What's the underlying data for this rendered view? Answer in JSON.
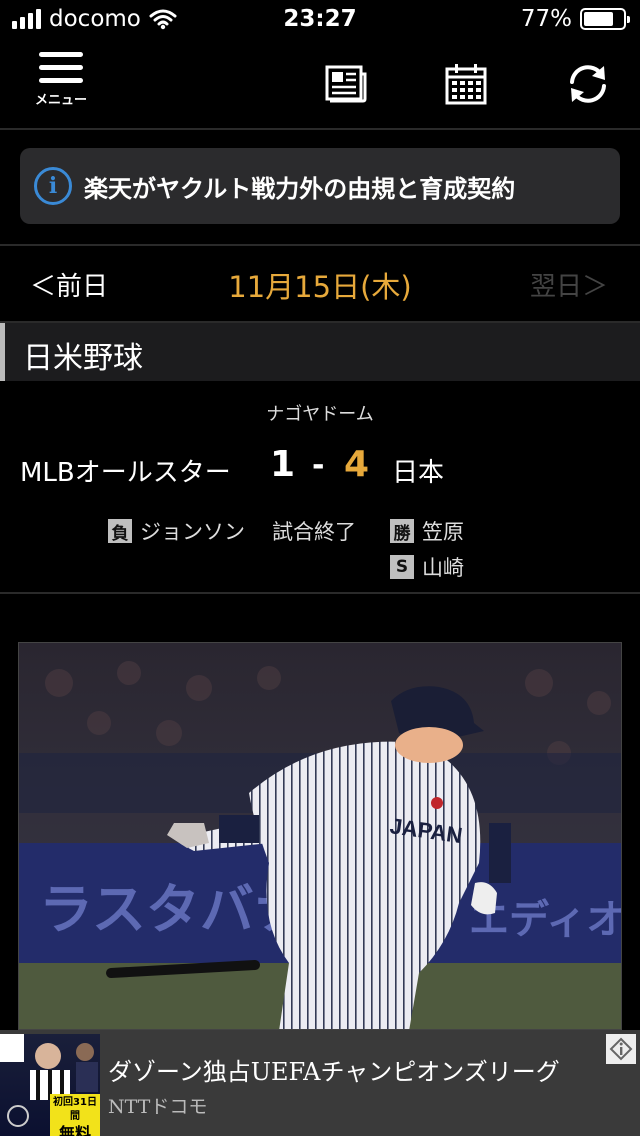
{
  "status_bar": {
    "carrier": "docomo",
    "time": "23:27",
    "battery_percent": "77%",
    "battery_level": 0.77
  },
  "toolbar": {
    "menu_label": "メニュー",
    "icons": [
      "menu-icon",
      "newspaper-icon",
      "calendar-icon",
      "refresh-icon"
    ]
  },
  "news": {
    "icon": "info-icon",
    "text": "楽天がヤクルト戦力外の由規と育成契約"
  },
  "date_nav": {
    "prev": "＜前日",
    "date": "11月15日(木)",
    "next": "翌日＞"
  },
  "league": {
    "name": "日米野球"
  },
  "game": {
    "venue": "ナゴヤドーム",
    "away_team": "MLBオールスター",
    "away_score": "1",
    "separator": "-",
    "home_score": "4",
    "home_team": "日本",
    "status": "試合終了",
    "losing_badge": "負",
    "losing_pitcher": "ジョンソン",
    "winning_badge": "勝",
    "winning_pitcher": "笠原",
    "save_badge": "S",
    "save_pitcher": "山崎"
  },
  "ad": {
    "title": "ダゾーン独占UEFAチャンピオンズリーグ",
    "sponsor": "NTTドコモ",
    "badge_small": "初回31日間",
    "badge_big": "無料"
  },
  "colors": {
    "accent_orange": "#e7a93b",
    "info_blue": "#3a8ad6",
    "background": "#000000"
  }
}
